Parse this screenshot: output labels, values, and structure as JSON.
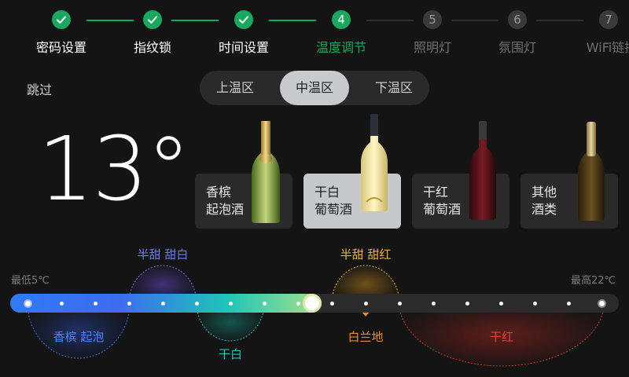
{
  "steps": [
    {
      "label": "密码设置",
      "status": "done"
    },
    {
      "label": "指纹锁",
      "status": "done"
    },
    {
      "label": "时间设置",
      "status": "done"
    },
    {
      "label": "温度调节",
      "number": "4",
      "status": "active"
    },
    {
      "label": "照明灯",
      "number": "5",
      "status": "pending"
    },
    {
      "label": "氛围灯",
      "number": "6",
      "status": "pending"
    },
    {
      "label": "WiFi链接",
      "number": "7",
      "status": "pending"
    }
  ],
  "skip_label": "跳过",
  "zones": [
    "上温区",
    "中温区",
    "下温区"
  ],
  "selected_zone": "中温区",
  "temperature": "13°",
  "wines": [
    {
      "line1": "香槟",
      "line2": "起泡酒"
    },
    {
      "line1": "干白",
      "line2": "葡萄酒"
    },
    {
      "line1": "干红",
      "line2": "葡萄酒"
    },
    {
      "line1": "其他",
      "line2": "酒类"
    }
  ],
  "selected_wine": "干白葡萄酒",
  "slider": {
    "min_label": "最低5℃",
    "max_label": "最高22℃",
    "min": 5,
    "max": 22,
    "value": 13
  },
  "ranges": {
    "semi_sweet_white": "半甜 甜白",
    "semi_sweet_red": "半甜 甜红",
    "champagne": "香槟 起泡",
    "dry_white": "干白",
    "brandy": "白兰地",
    "dry_red": "干红"
  },
  "colors": {
    "accent_green": "#1aa85e",
    "blue": "#2f7bf5",
    "teal": "#1ec6b8",
    "orange": "#f0a020",
    "red": "#d9342b"
  }
}
